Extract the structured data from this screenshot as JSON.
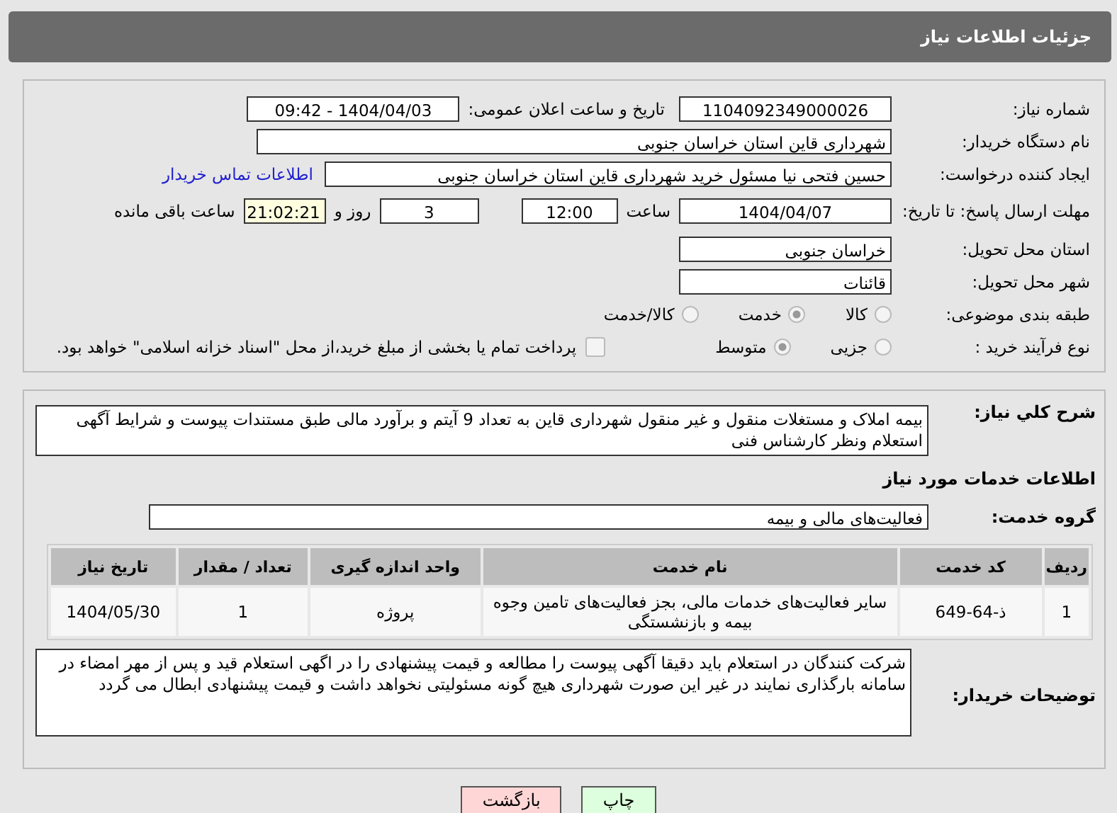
{
  "header": {
    "title": "جزئیات اطلاعات نیاز"
  },
  "need_number": {
    "label": "شماره نیاز:",
    "value": "1104092349000026"
  },
  "announce": {
    "label": "تاریخ و ساعت اعلان عمومی:",
    "value": "1404/04/03 - 09:42"
  },
  "buyer_org": {
    "label": "نام دستگاه خریدار:",
    "value": "شهرداری قاین استان خراسان جنوبی"
  },
  "requester": {
    "label": "ایجاد کننده درخواست:",
    "value": "حسین فتحی نیا مسئول خرید شهرداری قاین استان خراسان جنوبی",
    "link": "اطلاعات تماس خریدار"
  },
  "deadline": {
    "label": "مهلت ارسال پاسخ: تا تاریخ:",
    "date": "1404/04/07",
    "time_label": "ساعت",
    "time": "12:00",
    "days": "3",
    "days_label": "روز و",
    "remaining": "21:02:21",
    "remaining_label": "ساعت باقی مانده"
  },
  "province": {
    "label": "استان محل تحویل:",
    "value": "خراسان جنوبی"
  },
  "city": {
    "label": "شهر محل تحویل:",
    "value": "قائنات"
  },
  "category": {
    "label": "طبقه بندی موضوعی:",
    "options": [
      {
        "label": "کالا",
        "selected": false
      },
      {
        "label": "خدمت",
        "selected": true
      },
      {
        "label": "کالا/خدمت",
        "selected": false
      }
    ]
  },
  "process": {
    "label": "نوع فرآیند خرید :",
    "options": [
      {
        "label": "جزیی",
        "selected": false
      },
      {
        "label": "متوسط",
        "selected": true
      }
    ],
    "payment": {
      "checked": false,
      "text": "پرداخت تمام یا بخشی از مبلغ خرید،از محل \"اسناد خزانه اسلامی\" خواهد بود."
    }
  },
  "description": {
    "label": "شرح کلي نیاز:",
    "text": "بیمه املاک و مستغلات منقول و غیر منقول شهرداری قاین به تعداد 9 آیتم و برآورد مالی طبق مستندات پیوست و شرایط آگهی استعلام ونظر کارشناس فنی"
  },
  "services_title": "اطلاعات خدمات مورد نیاز",
  "service_group": {
    "label": "گروه خدمت:",
    "value": "فعالیت‌های مالی و بیمه"
  },
  "table": {
    "columns": [
      "ردیف",
      "کد خدمت",
      "نام خدمت",
      "واحد اندازه گیری",
      "تعداد / مقدار",
      "تاریخ نیاز"
    ],
    "rows": [
      [
        "1",
        "ذ-64-649",
        "سایر فعالیت‌های خدمات مالی، بجز فعالیت‌های تامین وجوه بیمه و بازنشستگی",
        "پروژه",
        "1",
        "1404/05/30"
      ]
    ]
  },
  "buyer_notes": {
    "label": "توضیحات خریدار:",
    "text": "شرکت کنندگان در استعلام باید دقیقا آگهی پیوست را مطالعه و قیمت پیشنهادی را در اگهی استعلام قید و پس از مهر امضاء در سامانه بارگذاری نمایند در غیر این صورت شهرداری هیچ گونه مسئولیتی نخواهد داشت و قیمت پیشنهادی ابطال می گردد"
  },
  "buttons": [
    {
      "label": "چاپ",
      "kind": "print"
    },
    {
      "label": "بازگشت",
      "kind": "back"
    }
  ]
}
